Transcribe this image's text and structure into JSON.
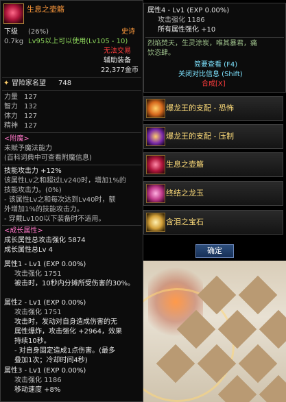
{
  "item": {
    "name": "生息之壶觞",
    "grade": "下级",
    "grade_pct": "(26%)",
    "rarity": "史诗",
    "weight": "0.7kg",
    "level_req": "Lv95以上可以使用(Lv105 - 10)",
    "trade": "无法交易",
    "type": "辅助装备",
    "price": "22,377金币"
  },
  "fame": {
    "label": "冒险家名望",
    "value": "748"
  },
  "stats": [
    {
      "label": "力量",
      "value": "127"
    },
    {
      "label": "智力",
      "value": "132"
    },
    {
      "label": "体力",
      "value": "127"
    },
    {
      "label": "精神",
      "value": "127"
    }
  ],
  "enchant": {
    "title": "<附魔>",
    "line1": "未赋予魔法能力",
    "line2": "(百科词典中可查看附魔信息)"
  },
  "skill": {
    "line1": "技能攻击力 +12%",
    "line2": "该属性Lv之和超过Lv240时，增加1%的",
    "line3": "技能攻击力。(0%)",
    "line4": "- 该属性Lv之和每次达到Lv40时，额",
    "line5": "外增加1%的技能攻击力。",
    "line6": "- 穿戴Lv100以下装备时不适用。"
  },
  "growth": {
    "title": "<成长属性>",
    "total_atk": "成长属性总攻击强化 5874",
    "total_lv": "成长属性总Lv 4",
    "attrs": [
      {
        "head": "属性1 - Lv1 (EXP 0.00%)",
        "atk": "攻击强化 1751",
        "d1": "被击时，10秒内分摊所受伤害的30%。",
        "d2": "",
        "d3": ""
      },
      {
        "head": "属性2 - Lv1 (EXP 0.00%)",
        "atk": "攻击强化 1751",
        "d1": "攻击时，发动对自身造成伤害的无",
        "d2": "属性爆炸，攻击强化 +2964，效果",
        "d3": "持续10秒。"
      },
      {
        "head": "属性3 - Lv1 (EXP 0.00%)",
        "atk": "攻击强化 1186",
        "d1": "移动速度 +8%",
        "d2": "",
        "d3": ""
      }
    ],
    "attr2_extra1": "- 对自身固定造成1点伤害。(最多",
    "attr2_extra2": "叠加1次；冷却时间4秒)"
  },
  "side": {
    "attr4": "属性4 - Lv1 (EXP 0.00%)",
    "atk": "攻击强化 1186",
    "all": "所有属性强化 +10",
    "flavor1": "烈焰焚天，生灵涂炭，唯其暴君，痛",
    "flavor2": "饮恣肆。",
    "brief": "简要查看 (F4)",
    "close_cmp": "关闭对比信息 (Shift)",
    "synth": "合成[X]"
  },
  "list_items": [
    {
      "label": "爆龙王的支配 - 恐怖",
      "color": "#d76a1e"
    },
    {
      "label": "爆龙王的支配 - 压制",
      "color": "#7a2aa8"
    },
    {
      "label": "生息之壶觞",
      "color": "#b0163c"
    },
    {
      "label": "终结之龙玉",
      "color": "#c03a8a"
    },
    {
      "label": "含泪之宝石",
      "color": "#d4a13a"
    }
  ],
  "confirm_label": "确定"
}
